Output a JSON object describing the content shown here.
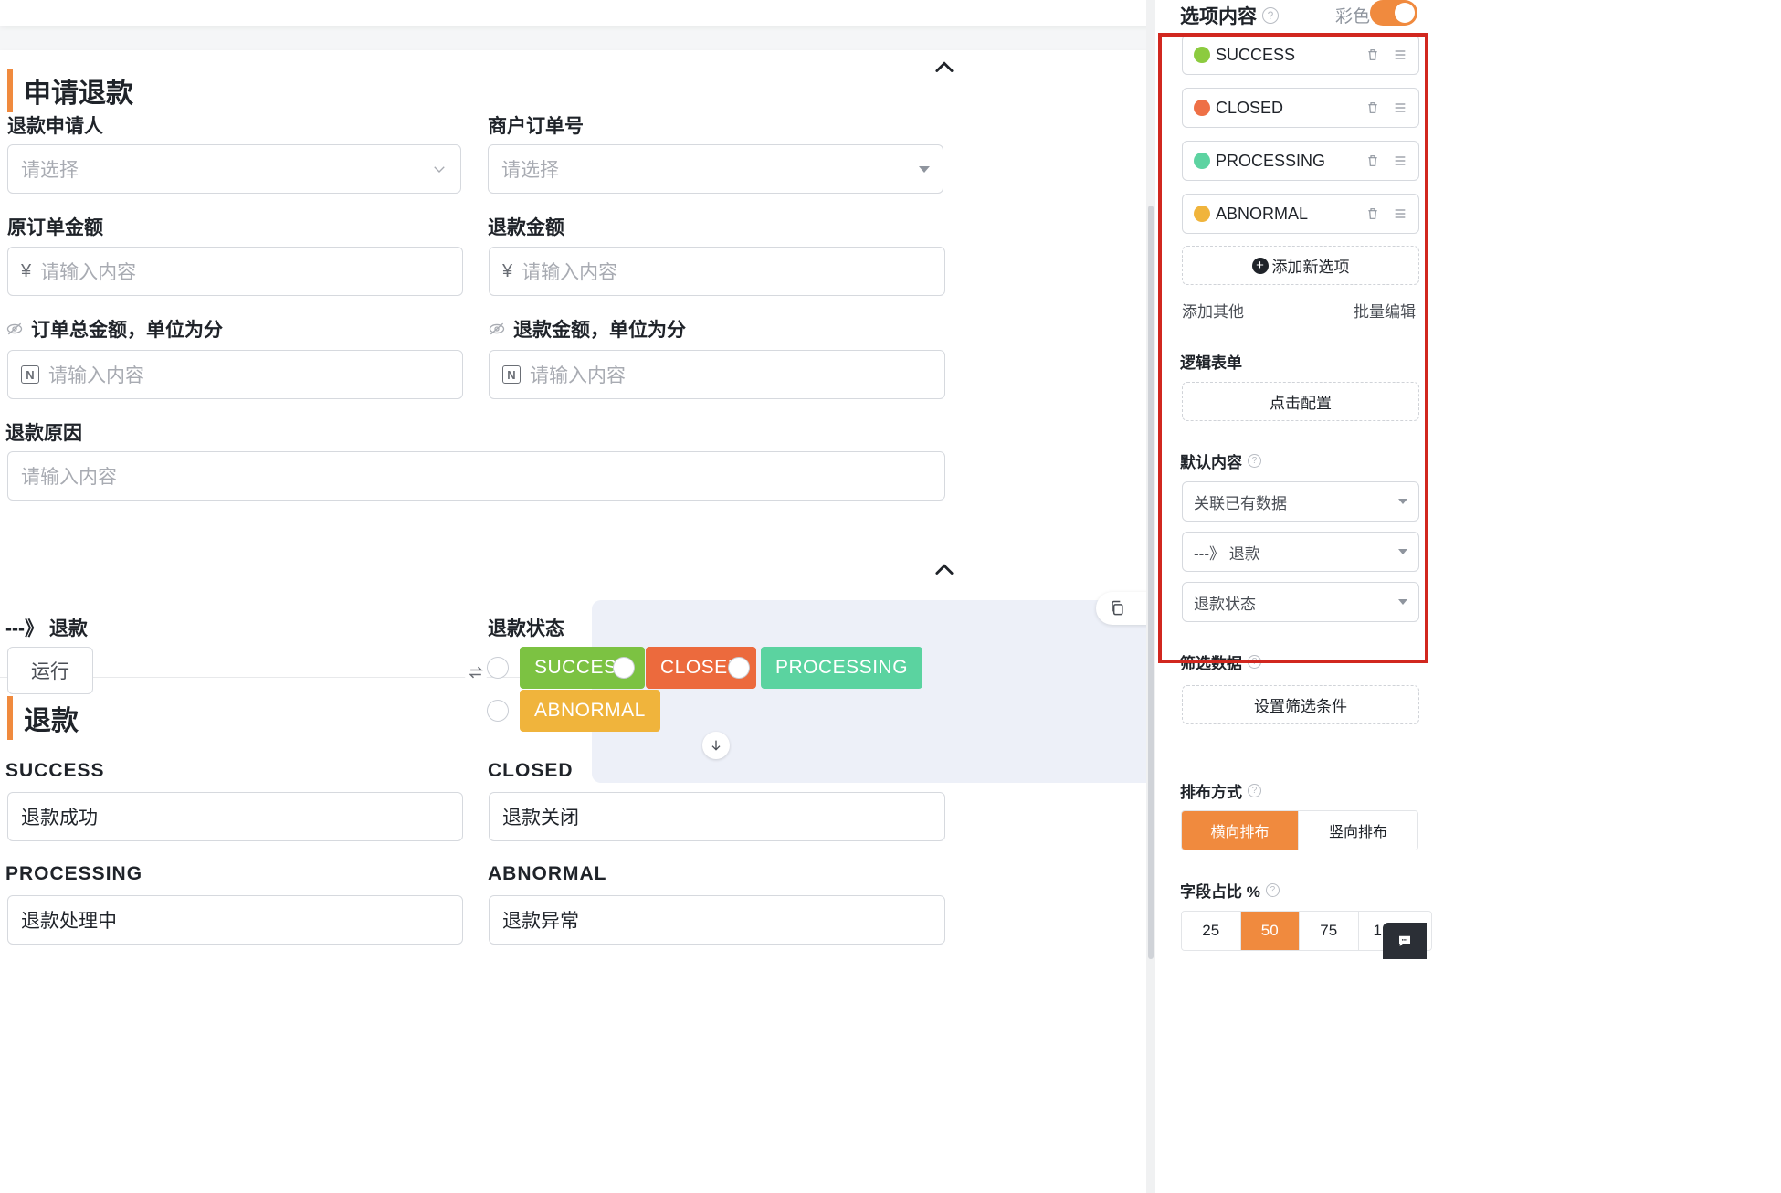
{
  "form": {
    "section1": {
      "title": "申请退款",
      "fields": {
        "applicant": {
          "label": "退款申请人",
          "placeholder": "请选择"
        },
        "order_no": {
          "label": "商户订单号",
          "placeholder": "请选择"
        },
        "orig_amount": {
          "label": "原订单金额",
          "prefix": "¥",
          "placeholder": "请输入内容"
        },
        "refund_amount": {
          "label": "退款金额",
          "prefix": "¥",
          "placeholder": "请输入内容"
        },
        "total_cents": {
          "label": "订单总金额，单位为分",
          "prefix": "N",
          "placeholder": "请输入内容"
        },
        "refund_cents": {
          "label": "退款金额，单位为分",
          "prefix": "N",
          "placeholder": "请输入内容"
        },
        "reason": {
          "label": "退款原因",
          "placeholder": "请输入内容"
        }
      }
    },
    "section2": {
      "title": "退款",
      "link_label": "---》 退款",
      "run_button": "运行",
      "status_label": "退款状态",
      "options": [
        {
          "label": "SUCCESS",
          "color": "#7cc242"
        },
        {
          "label": "CLOSED",
          "color": "#ec6a3d"
        },
        {
          "label": "PROCESSING",
          "color": "#5bd3a0"
        },
        {
          "label": "ABNORMAL",
          "color": "#f0b43c"
        }
      ],
      "mapped": [
        {
          "label": "SUCCESS",
          "value": "退款成功"
        },
        {
          "label": "CLOSED",
          "value": "退款关闭"
        },
        {
          "label": "PROCESSING",
          "value": "退款处理中"
        },
        {
          "label": "ABNORMAL",
          "value": "退款异常"
        }
      ]
    }
  },
  "panel": {
    "options_title": "选项内容",
    "colorful_label": "彩色",
    "colorful_on": true,
    "items": [
      {
        "label": "SUCCESS",
        "color": "#8ccb3f"
      },
      {
        "label": "CLOSED",
        "color": "#ee7046"
      },
      {
        "label": "PROCESSING",
        "color": "#5dd3a1"
      },
      {
        "label": "ABNORMAL",
        "color": "#f0b43c"
      }
    ],
    "add_option": "添加新选项",
    "add_other": "添加其他",
    "batch_edit": "批量编辑",
    "logic_title": "逻辑表单",
    "logic_btn": "点击配置",
    "default_title": "默认内容",
    "default_dd": [
      "关联已有数据",
      "---》 退款",
      "退款状态"
    ],
    "filter_title": "筛选数据",
    "filter_btn": "设置筛选条件",
    "layout_title": "排布方式",
    "layout_opts": [
      "横向排布",
      "竖向排布"
    ],
    "layout_selected": "横向排布",
    "width_title": "字段占比 %",
    "width_opts": [
      "25",
      "50",
      "75",
      "1"
    ],
    "width_selected": "50"
  },
  "icons": [
    "chevron-up-icon",
    "chevron-down-icon",
    "caret-down-icon",
    "eye-off-icon",
    "copy-icon",
    "trash-icon",
    "drag-handle-icon",
    "swap-icon",
    "arrow-down-icon",
    "plus-icon",
    "help-icon",
    "chat-icon"
  ]
}
